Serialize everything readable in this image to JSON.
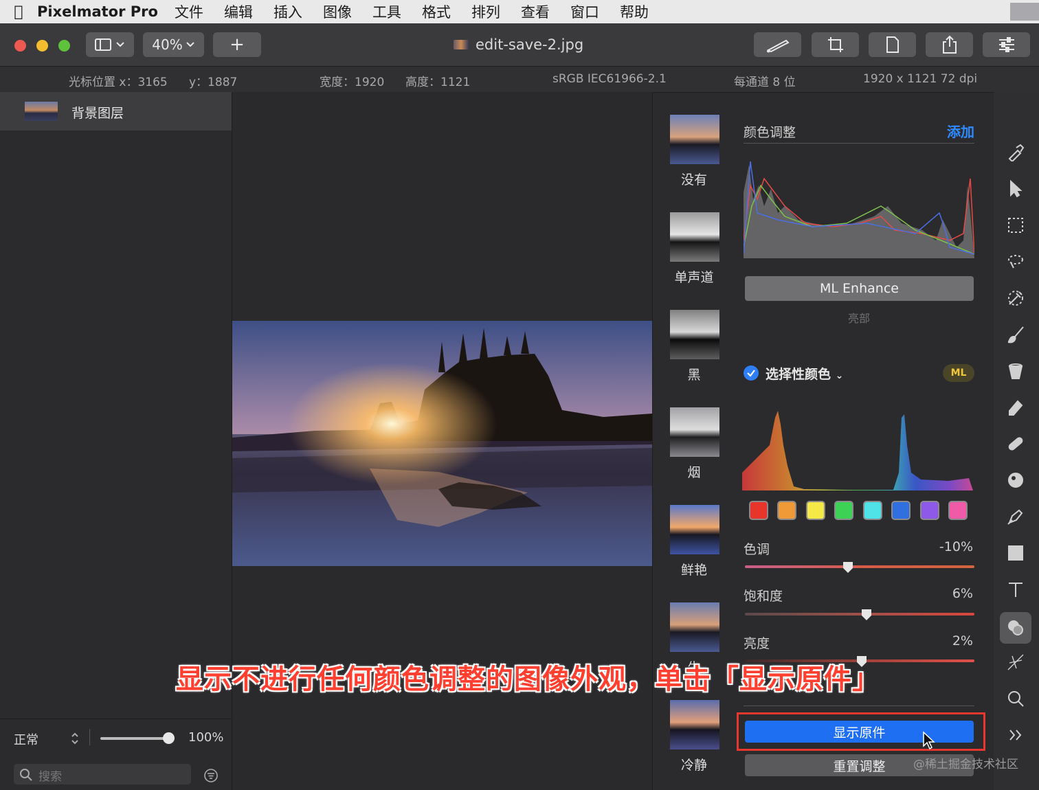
{
  "menubar": {
    "app": "Pixelmator Pro",
    "items": [
      "文件",
      "编辑",
      "插入",
      "图像",
      "工具",
      "格式",
      "排列",
      "查看",
      "窗口",
      "帮助"
    ]
  },
  "toolbar": {
    "zoom": "40%",
    "add_label": "+",
    "doc_title": "edit-save-2.jpg"
  },
  "infobar": {
    "cursor_x": "光标位置 x：3165",
    "cursor_y": "y：1887",
    "width": "宽度：1920",
    "height": "高度：1121",
    "profile": "sRGB IEC61966-2.1",
    "depth": "每通道 8 位",
    "size_dpi": "1920 x 1121 72 dpi"
  },
  "layers": {
    "layer_name": "背景图层",
    "blend_mode": "正常",
    "opacity": "100%",
    "opacity_value": 1.0,
    "search_placeholder": "搜索"
  },
  "presets": [
    "没有",
    "单声道",
    "黑",
    "烟",
    "鲜艳",
    "生",
    "冷静"
  ],
  "adjust": {
    "title": "颜色调整",
    "add_label": "添加",
    "ml_enhance": "ML Enhance",
    "highlights": "亮部",
    "selective_color": "选择性颜色",
    "ml_badge": "ML",
    "swatch_colors": [
      "#e8352b",
      "#f09a37",
      "#f5e947",
      "#3dd156",
      "#4fe3e8",
      "#2f6fe0",
      "#8e58e8",
      "#f05aa8"
    ],
    "sliders": [
      {
        "label": "色调",
        "value": "-10%",
        "level": -0.1
      },
      {
        "label": "饱和度",
        "value": "6%",
        "level": 0.06
      },
      {
        "label": "亮度",
        "value": "2%",
        "level": 0.02
      }
    ],
    "show_original": "显示原件",
    "reset": "重置调整"
  },
  "caption": "显示不进行任何颜色调整的图像外观，单击「显示原件」",
  "watermark": "@稀土掘金技术社区"
}
